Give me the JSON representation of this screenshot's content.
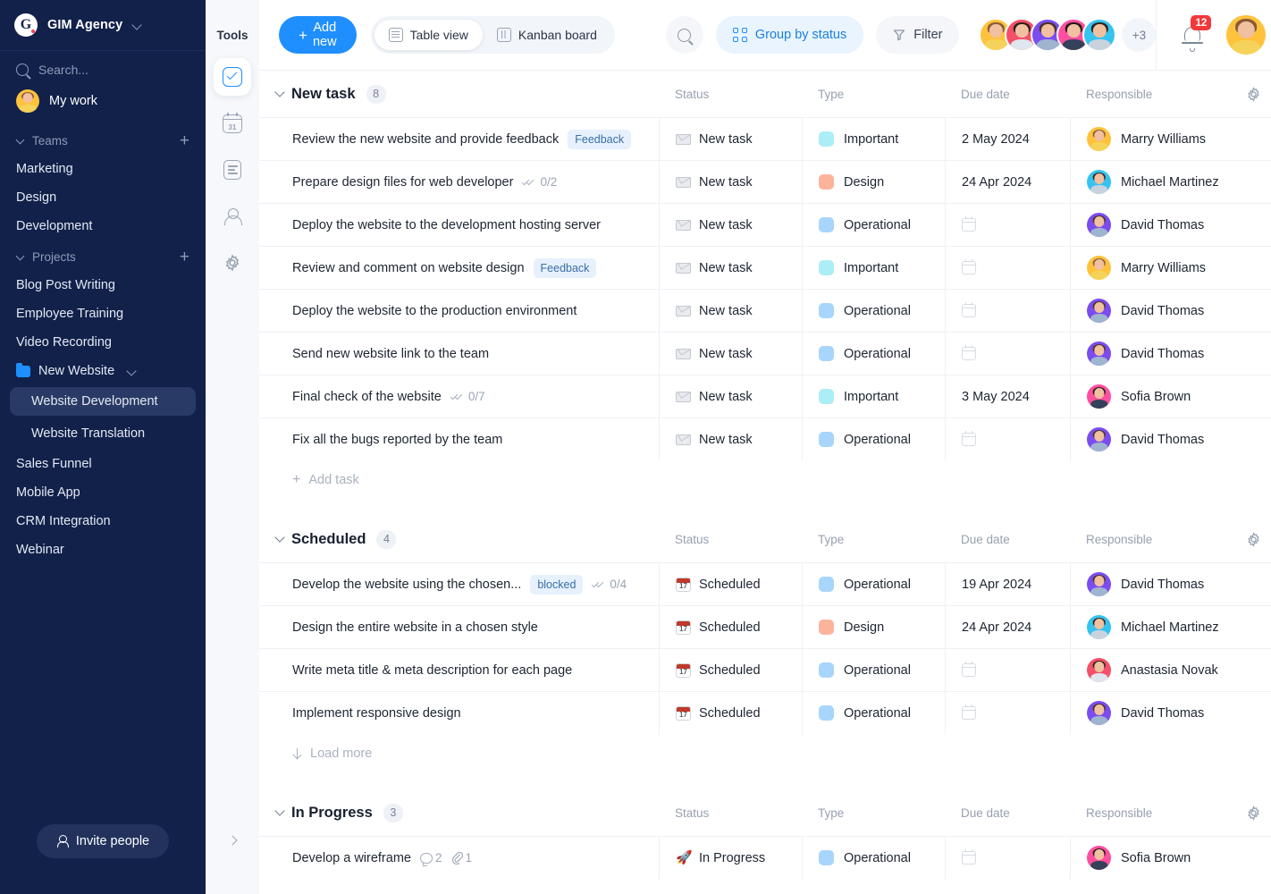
{
  "sidebar": {
    "workspace": {
      "initial": "G",
      "name": "GIM Agency",
      "caret": "chevron-down-icon"
    },
    "search_placeholder": "Search...",
    "my_work": "My work",
    "teams_label": "Teams",
    "teams": [
      {
        "label": "Marketing"
      },
      {
        "label": "Design"
      },
      {
        "label": "Development"
      }
    ],
    "projects_label": "Projects",
    "projects": [
      {
        "label": "Blog Post Writing",
        "type": "item"
      },
      {
        "label": "Employee Training",
        "type": "item"
      },
      {
        "label": "Video Recording",
        "type": "item"
      },
      {
        "label": "New Website",
        "type": "folder"
      }
    ],
    "folder_children": [
      {
        "label": "Website Development",
        "active": true
      },
      {
        "label": "Website Translation",
        "active": false
      }
    ],
    "projects_after": [
      {
        "label": "Sales Funnel"
      },
      {
        "label": "Mobile App"
      },
      {
        "label": "CRM Integration"
      },
      {
        "label": "Webinar"
      }
    ],
    "invite_label": "Invite people"
  },
  "tools": {
    "title": "Tools",
    "items": [
      {
        "icon": "tasks-check-icon",
        "active": true
      },
      {
        "icon": "calendar-31-icon",
        "active": false
      },
      {
        "icon": "document-icon",
        "active": false
      },
      {
        "icon": "person-icon",
        "active": false
      },
      {
        "icon": "gear-icon",
        "active": false
      }
    ],
    "expand": "chevron-right-icon"
  },
  "topbar": {
    "add_new": "Add new",
    "views": [
      {
        "label": "Table view",
        "icon": "table-icon",
        "active": true
      },
      {
        "label": "Kanban board",
        "icon": "kanban-icon",
        "active": false
      }
    ],
    "search_icon": "search-icon",
    "group_by": "Group by status",
    "filter": "Filter",
    "avatars": [
      "#ffc23c",
      "#f4506a",
      "#7b4cf0",
      "#ff4fa0",
      "#35c3f0"
    ],
    "overflow": "+3",
    "notifications": "12",
    "accent": "#1f8fff"
  },
  "columns": {
    "status": "Status",
    "type": "Type",
    "due": "Due date",
    "responsible": "Responsible",
    "settings": "gear-icon"
  },
  "type_colors": {
    "Important": "#aceef5",
    "Design": "#fbb49b",
    "Operational": "#a8d5fb"
  },
  "avatar_colors": {
    "Marry Williams": "#ffc23c",
    "Michael Martinez": "#35c3f0",
    "David Thomas": "#7b4cf0",
    "Sofia Brown": "#ff4fa0",
    "Anastasia Novak": "#f4506a"
  },
  "groups": [
    {
      "title": "New task",
      "count": "8",
      "footer": {
        "kind": "add",
        "label": "Add task"
      },
      "rows": [
        {
          "name": "Review the new website and provide feedback",
          "tag": "Feedback",
          "status": "New task",
          "status_icon": "envelope-icon",
          "type": "Important",
          "due": "2 May 2024",
          "responsible": "Marry Williams"
        },
        {
          "name": "Prepare design files for web developer",
          "subtasks": "0/2",
          "status": "New task",
          "status_icon": "envelope-icon",
          "type": "Design",
          "due": "24 Apr 2024",
          "responsible": "Michael Martinez"
        },
        {
          "name": "Deploy the website to the development hosting server",
          "status": "New task",
          "status_icon": "envelope-icon",
          "type": "Operational",
          "due": "",
          "responsible": "David Thomas"
        },
        {
          "name": "Review and comment on website design",
          "tag": "Feedback",
          "status": "New task",
          "status_icon": "envelope-icon",
          "type": "Important",
          "due": "",
          "responsible": "Marry Williams"
        },
        {
          "name": "Deploy the website to the production environment",
          "status": "New task",
          "status_icon": "envelope-icon",
          "type": "Operational",
          "due": "",
          "responsible": "David Thomas"
        },
        {
          "name": "Send new website link to the team",
          "status": "New task",
          "status_icon": "envelope-icon",
          "type": "Operational",
          "due": "",
          "responsible": "David Thomas"
        },
        {
          "name": "Final check of the website",
          "subtasks": "0/7",
          "status": "New task",
          "status_icon": "envelope-icon",
          "type": "Important",
          "due": "3 May 2024",
          "responsible": "Sofia Brown"
        },
        {
          "name": "Fix all the bugs reported by the team",
          "status": "New task",
          "status_icon": "envelope-icon",
          "type": "Operational",
          "due": "",
          "responsible": "David Thomas"
        }
      ]
    },
    {
      "title": "Scheduled",
      "count": "4",
      "footer": {
        "kind": "load",
        "label": "Load more"
      },
      "rows": [
        {
          "name": "Develop the website using the chosen...",
          "tag": "blocked",
          "subtasks": "0/4",
          "status": "Scheduled",
          "status_icon": "calendar-17-icon",
          "type": "Operational",
          "due": "19 Apr 2024",
          "responsible": "David Thomas"
        },
        {
          "name": "Design the entire website in a chosen style",
          "status": "Scheduled",
          "status_icon": "calendar-17-icon",
          "type": "Design",
          "due": "24 Apr 2024",
          "responsible": "Michael Martinez"
        },
        {
          "name": "Write meta title & meta description for each page",
          "status": "Scheduled",
          "status_icon": "calendar-17-icon",
          "type": "Operational",
          "due": "",
          "responsible": "Anastasia Novak"
        },
        {
          "name": "Implement responsive design",
          "status": "Scheduled",
          "status_icon": "calendar-17-icon",
          "type": "Operational",
          "due": "",
          "responsible": "David Thomas"
        }
      ]
    },
    {
      "title": "In Progress",
      "count": "3",
      "rows": [
        {
          "name": "Develop a wireframe",
          "comments": "2",
          "attachments": "1",
          "status": "In Progress",
          "status_icon": "rocket-icon",
          "type": "Operational",
          "due": "",
          "responsible": "Sofia Brown"
        }
      ]
    }
  ]
}
